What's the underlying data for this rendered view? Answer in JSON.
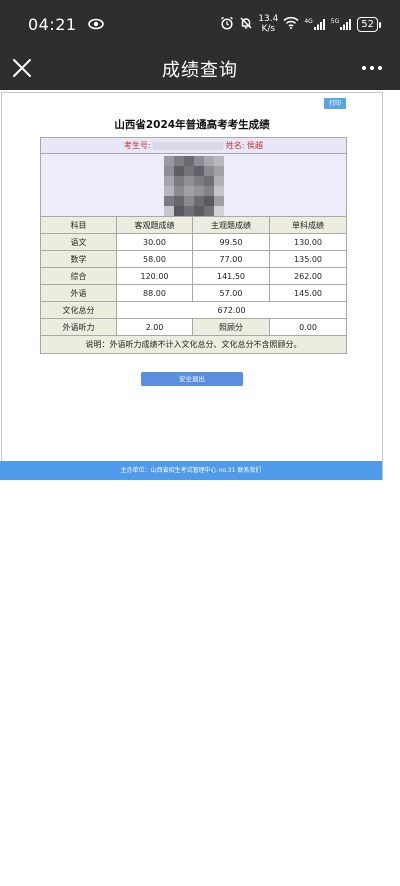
{
  "status_bar": {
    "time": "04:21",
    "net_speed_value": "13.4",
    "net_speed_unit": "K/s",
    "signal_1_type": "4G",
    "signal_2_type": "5G",
    "battery": "52",
    "icons": [
      "eye-icon",
      "alarm-icon",
      "bell-off-icon",
      "wifi-icon",
      "signal-icon",
      "signal-icon",
      "battery-icon"
    ]
  },
  "app_bar": {
    "title": "成绩查询",
    "close_icon": "close-icon",
    "more_icon": "more-icon"
  },
  "page": {
    "print_button": "打印",
    "title": "山西省2024年普通高考考生成绩",
    "candidate": {
      "number_label": "考生号:",
      "name_label": "姓名:",
      "name_value": "侯越"
    },
    "table": {
      "headers": [
        "科目",
        "客观题成绩",
        "主观题成绩",
        "单科成绩"
      ],
      "rows": [
        {
          "subject": "语文",
          "objective": "30.00",
          "subjective": "99.50",
          "total": "130.00"
        },
        {
          "subject": "数学",
          "objective": "58.00",
          "subjective": "77.00",
          "total": "135.00"
        },
        {
          "subject": "综合",
          "objective": "120.00",
          "subjective": "141.50",
          "total": "262.00"
        },
        {
          "subject": "外语",
          "objective": "88.00",
          "subjective": "57.00",
          "total": "145.00"
        }
      ],
      "total_label": "文化总分",
      "total_value": "672.00",
      "listening_label": "外语听力",
      "listening_value": "2.00",
      "bonus_label": "照顾分",
      "bonus_value": "0.00",
      "note": "说明：外语听力成绩不计入文化总分、文化总分不含照顾分。"
    },
    "exit_button": "安全退出",
    "footer": "主办单位：山西省招生考试管理中心  no.31 联系我们"
  },
  "colors": {
    "status_bar_bg": "#2e2e2e",
    "accent_blue": "#4f9bea",
    "candidate_text": "#c8302e",
    "table_header_bg": "#ececdf",
    "info_bg": "#e7e7f7"
  }
}
